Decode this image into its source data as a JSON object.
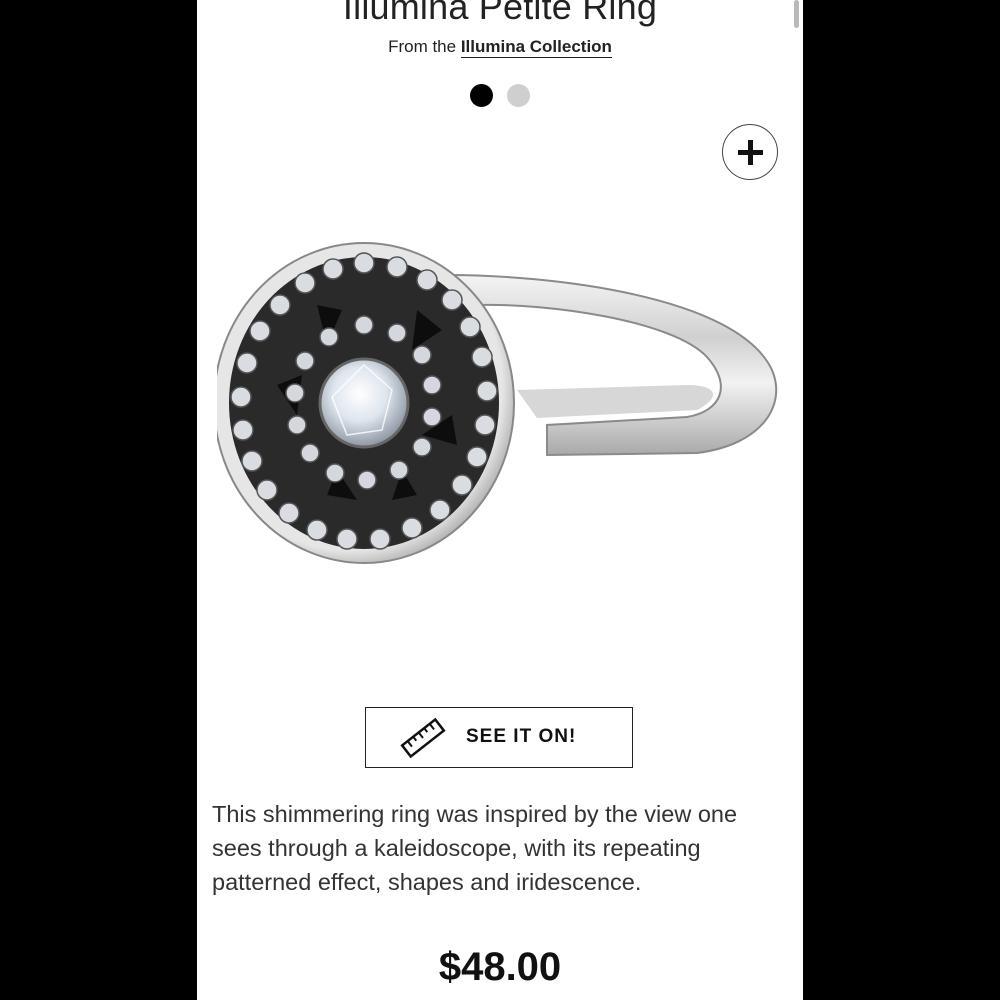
{
  "product": {
    "title": "Illumina Petite Ring",
    "from_prefix": "From the ",
    "collection_link": "Illumina Collection",
    "description": "This shimmering ring was inspired by the view one sees through a kaleidoscope, with its repeating patterned effect, shapes and iridescence.",
    "price": "$48.00"
  },
  "gallery": {
    "slide_count": 2,
    "active_slide": 1,
    "zoom_icon": "plus-icon"
  },
  "actions": {
    "see_it_on_label": "SEE IT ON!",
    "see_it_on_icon": "ruler-icon"
  },
  "colors": {
    "text": "#222222",
    "active_dot": "#000000",
    "inactive_dot": "#cfcfcf",
    "frame": "#000000"
  }
}
